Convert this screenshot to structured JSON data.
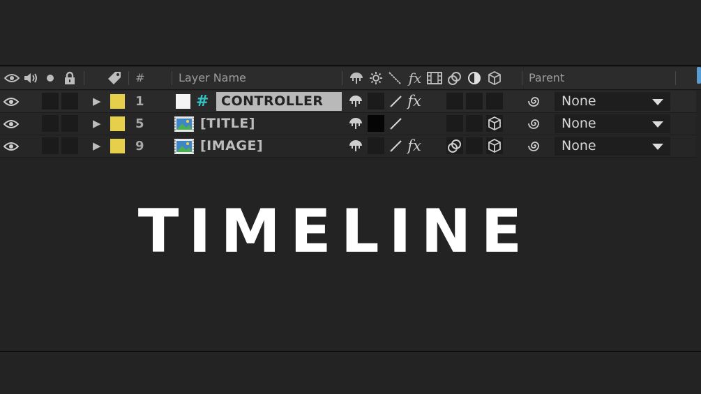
{
  "header": {
    "col_number": "#",
    "col_layer_name": "Layer Name",
    "col_parent": "Parent",
    "av_icons": [
      "eye-icon",
      "speaker-icon",
      "solo-dot-icon",
      "lock-icon"
    ],
    "switch_icons": [
      "shy-icon",
      "collapse-sun-icon",
      "quality-icon",
      "fx-icon",
      "frame-blend-icon",
      "motion-blur-icon",
      "adjustment-icon",
      "3d-cube-icon"
    ],
    "fx_label": "fx"
  },
  "layers": [
    {
      "number": "1",
      "name": "CONTROLLER",
      "type": "null",
      "parent": "None",
      "fx": "fx"
    },
    {
      "number": "5",
      "name": "[TITLE]",
      "type": "footage",
      "parent": "None",
      "fx": ""
    },
    {
      "number": "9",
      "name": "[IMAGE]",
      "type": "footage",
      "parent": "None",
      "fx": "fx"
    }
  ],
  "overlay_title": "TIMELINE",
  "colors": {
    "background": "#232323",
    "label_yellow": "#e6cf4a",
    "null_hash": "#35c2c2",
    "selected_name_bg": "#b9b9b9"
  }
}
